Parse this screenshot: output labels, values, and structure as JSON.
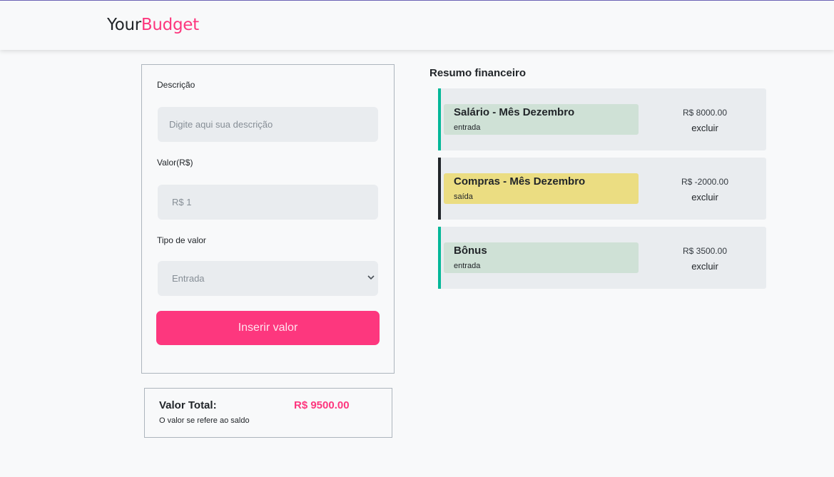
{
  "header": {
    "brand_part1": "Your",
    "brand_part2": "Budget"
  },
  "form": {
    "description_label": "Descrição",
    "description_placeholder": "Digite aqui sua descrição",
    "value_label": "Valor(R$)",
    "value_placeholder": "R$ 1",
    "type_label": "Tipo de valor",
    "type_selected": "Entrada",
    "submit_label": "Inserir valor"
  },
  "total": {
    "label": "Valor Total:",
    "value": "R$ 9500.00",
    "note": "O valor se refere ao saldo"
  },
  "summary": {
    "title": "Resumo financeiro",
    "entries": [
      {
        "title": "Salário - Mês Dezembro",
        "type": "entrada",
        "amount": "R$ 8000.00",
        "action": "excluir"
      },
      {
        "title": "Compras - Mês Dezembro",
        "type": "saída",
        "amount": "R$ -2000.00",
        "action": "excluir"
      },
      {
        "title": "Bônus",
        "type": "entrada",
        "amount": "R$ 3500.00",
        "action": "excluir"
      }
    ]
  },
  "colors": {
    "accent": "#fd377e",
    "income": "#03b898",
    "expense": "#212529"
  }
}
